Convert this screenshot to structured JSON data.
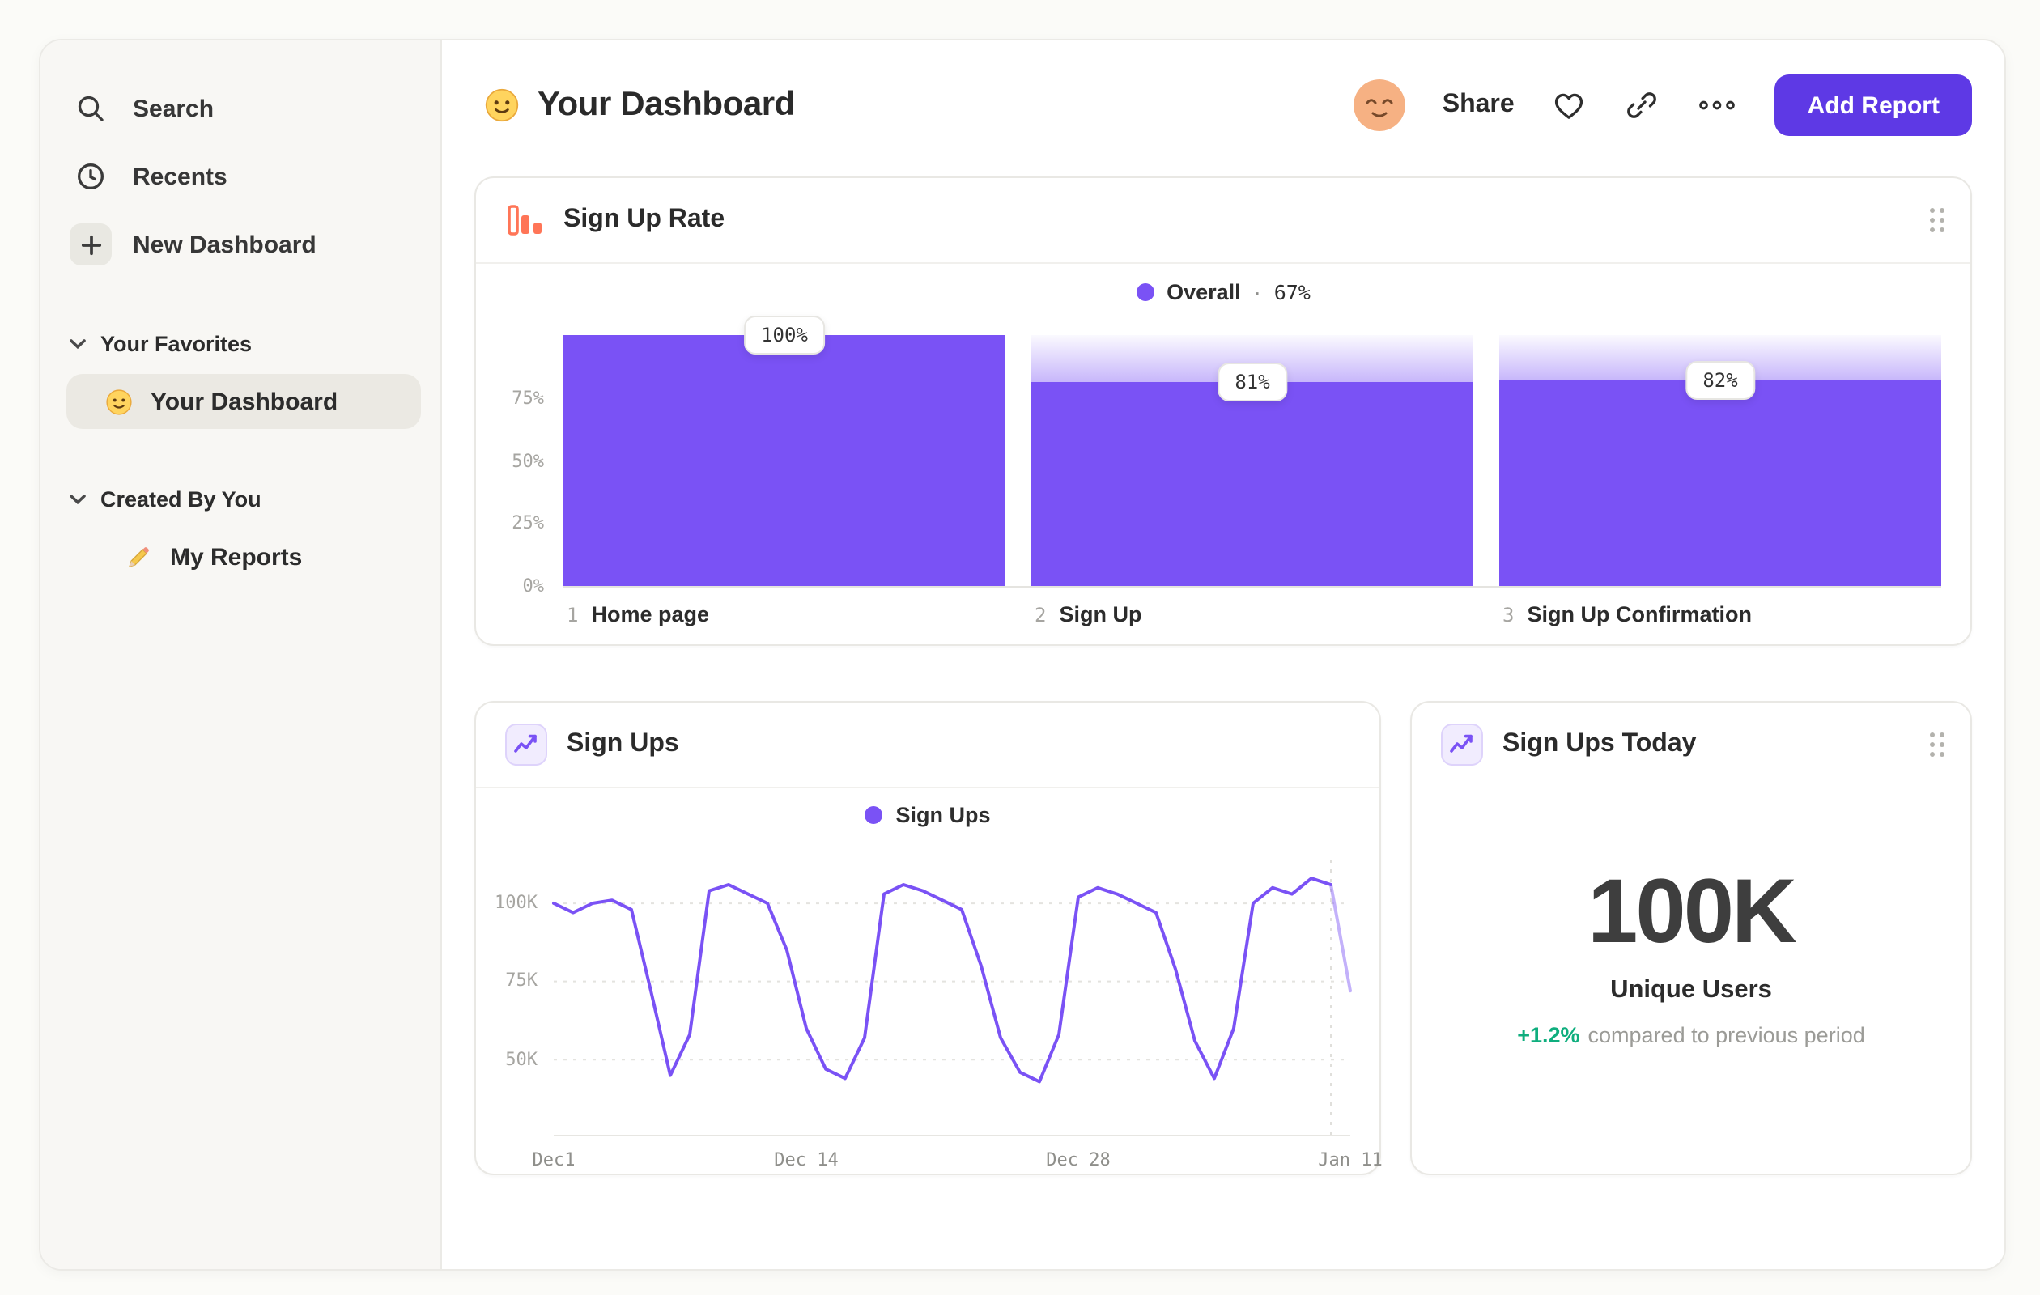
{
  "colors": {
    "accent_purple": "#7a52f5",
    "button_purple": "#5e39e5",
    "icon_orange": "#ff7557",
    "positive_green": "#0fae7e"
  },
  "sidebar": {
    "items": [
      {
        "label": "Search",
        "icon": "search-icon"
      },
      {
        "label": "Recents",
        "icon": "clock-icon"
      },
      {
        "label": "New Dashboard",
        "icon": "plus-icon"
      }
    ],
    "sections": [
      {
        "label": "Your Favorites",
        "icon": "chevron-down-icon",
        "items": [
          {
            "label": "Your Dashboard",
            "icon": "smiley-emoji",
            "selected": true
          }
        ]
      },
      {
        "label": "Created By You",
        "icon": "chevron-down-icon",
        "items": [
          {
            "label": "My Reports",
            "icon": "pencil-emoji",
            "selected": false
          }
        ]
      }
    ]
  },
  "header": {
    "emoji": "smiley-emoji",
    "title": "Your Dashboard",
    "share_label": "Share",
    "add_report_label": "Add Report"
  },
  "cards": {
    "signup_rate": {
      "title": "Sign Up Rate",
      "icon": "bar-chart-icon",
      "legend_label": "Overall",
      "legend_separator": "·",
      "legend_value": "67%"
    },
    "signups": {
      "title": "Sign Ups",
      "icon": "line-chart-icon",
      "legend_label": "Sign Ups"
    },
    "signups_today": {
      "title": "Sign Ups Today",
      "icon": "line-chart-icon",
      "value": "100K",
      "unit_label": "Unique Users",
      "delta": "+1.2%",
      "delta_note": "compared to previous period"
    }
  },
  "chart_data": [
    {
      "type": "bar",
      "subtype": "funnel",
      "title": "Sign Up Rate",
      "legend": [
        {
          "label": "Overall",
          "value": "67%"
        }
      ],
      "categories": [
        "Home page",
        "Sign Up",
        "Sign Up Confirmation"
      ],
      "step_numbers": [
        "1",
        "2",
        "3"
      ],
      "values": [
        100,
        81,
        82
      ],
      "value_labels": [
        "100%",
        "81%",
        "82%"
      ],
      "y_ticks": [
        {
          "label": "75%",
          "value": 75
        },
        {
          "label": "50%",
          "value": 50
        },
        {
          "label": "25%",
          "value": 25
        },
        {
          "label": "0%",
          "value": 0
        }
      ],
      "ylim": [
        0,
        100
      ],
      "bar_color": "#7a52f5"
    },
    {
      "type": "line",
      "title": "Sign Ups",
      "series_name": "Sign Ups",
      "x_ticks": [
        {
          "label": "Dec1",
          "day": 0
        },
        {
          "label": "Dec 14",
          "day": 13
        },
        {
          "label": "Dec 28",
          "day": 27
        },
        {
          "label": "Jan 11",
          "day": 41
        }
      ],
      "y_ticks": [
        {
          "label": "100K",
          "value": 100
        },
        {
          "label": "75K",
          "value": 75
        },
        {
          "label": "50K",
          "value": 50
        }
      ],
      "ylim_k": [
        26,
        114
      ],
      "values_k": [
        100,
        97,
        100,
        101,
        98,
        72,
        45,
        58,
        104,
        106,
        103,
        100,
        85,
        60,
        47,
        44,
        57,
        103,
        106,
        104,
        101,
        98,
        80,
        57,
        46,
        43,
        58,
        102,
        105,
        103,
        100,
        97,
        79,
        56,
        44,
        60,
        100,
        105,
        103,
        108,
        106,
        72
      ],
      "today_marker_day": 40,
      "line_color": "#7a52f5",
      "grid": true,
      "legend_position": "top-center"
    }
  ]
}
